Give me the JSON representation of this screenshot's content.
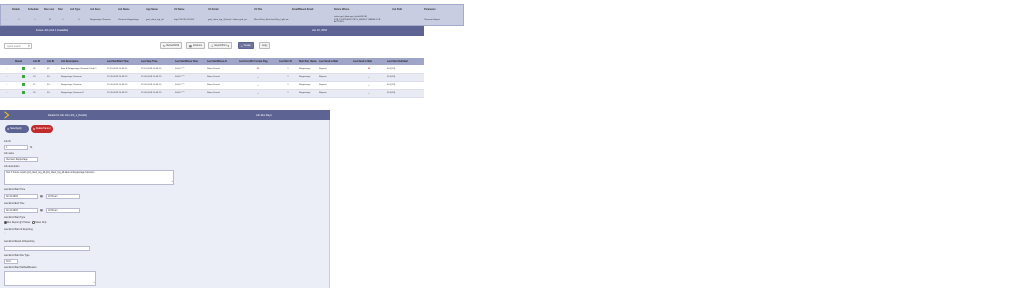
{
  "top_grid": {
    "headers": [
      "",
      "Details",
      "Schedule",
      "Run now",
      "Stat",
      "Job Type",
      "Job Desc",
      "Job Name",
      "App Name",
      "Url Name",
      "Url Email",
      "Url File",
      "Email/Based Email",
      "Notice Where",
      "Job Path",
      "Parameter"
    ],
    "row": {
      "col1": "...",
      "col2": "✓",
      "col3": "□",
      "col4": "↻",
      "col5": "✓",
      "col6": "0",
      "col7": "Reppertage Clemson",
      "col8": "Clemson Reppertage",
      "col9": "grid_client_log_all",
      "col10": "http://74.230.124.00/",
      "col11": "grid_client_log_@clemtl...lattice.grid_jor..",
      "col12": "\\Reco\\Print_Bon ftont.Rep_Lqtkr.stc",
      "col13": "",
      "col14": "select grd_fdate.grd_sfield FROM JOB_POSTERS,POSTS_RESULT PARSE JOB ACTIONS",
      "col15": "",
      "col16": "Clemson Report"
    }
  },
  "title_bar": {
    "left_text": "Future Job (Job 1 Available)",
    "right_text": "Jan 10, 2018"
  },
  "toolbar": {
    "search_placeholder": "Quick search",
    "btn_refresh": "Refresh/Poll",
    "btn_columns": "Columns",
    "btn_export": "Export/Print",
    "btn_create": "Create",
    "btn_copy": "Copy"
  },
  "job_list": {
    "headers": [
      "",
      "Result",
      "Job ID",
      "Job ID",
      "Job Description",
      "Last Run/Start Time",
      "Last Stop Time",
      "Last Start/Done Time",
      "Last Start/Done At",
      "Last Error/Type",
      "Last Error/Dir Format Flag",
      "Last Retr ID",
      "Next Run_Name",
      "Last Send to Mail",
      "Last Send to Mail",
      "Last Start-Out/Alert"
    ],
    "rows": [
      {
        "c1": "...",
        "c2": "✓",
        "c3": "28",
        "c4": "46",
        "c5": "Item E-Reppertage Clemson Draft O",
        "c6": "22-10-2018 10:09:11",
        "c7": "22-10-2018 10:09:13",
        "c8": "00:00 ****",
        "c9": "Notes Found",
        "c10": "✖",
        "c11": "1",
        "c12": "Reppertage",
        "c13": "Reports",
        "c14": "✖",
        "c15": "45.2(19)"
      },
      {
        "c1": "...",
        "c2": "✓",
        "c3": "24",
        "c4": "34",
        "c5": "Reppertage Clemson",
        "c6": "22-05-2018 10:09:13",
        "c7": "22-05-2018 10:09:13",
        "c8": "00:00 ****",
        "c9": "Notes Found",
        "c10": "✓",
        "c11": "1",
        "c12": "Reppertage",
        "c13": "Reports",
        "c14": "✓",
        "c15": "45.2(19)"
      },
      {
        "c1": "...",
        "c2": "✓",
        "c3": "22",
        "c4": "34",
        "c5": "Reppertage Clemson",
        "c6": "22-05-2018 10:09:13",
        "c7": "22-05-2018 10:09:13",
        "c8": "00:00 ****",
        "c9": "Notes Found",
        "c10": "✓",
        "c11": "1",
        "c12": "Reppertage",
        "c13": "Reports",
        "c14": "✓",
        "c15": "45.2(19)"
      },
      {
        "c1": "...",
        "c2": "✓",
        "c3": "20",
        "c4": "34",
        "c5": "Reppertage Clemson D",
        "c6": "22-05-2018 10:09:13",
        "c7": "22-05-2018 10:09:13",
        "c8": "00:00 ****",
        "c9": "Notes Found",
        "c10": "✓",
        "c11": "1",
        "c12": "Reppertage",
        "c13": "Reports",
        "c14": "✓",
        "c15": "45.2(19)"
      }
    ]
  },
  "edit_panel": {
    "header_left": "Details for Job Job (Job_1_Details)",
    "header_right": "Job Run Days",
    "save_label": "Save/Apply",
    "delete_label": "Delete/Cancel",
    "job_id_label": "Job ID",
    "job_id_value": "1",
    "job_name_label": "Job name",
    "job_name_value": "Clemson Reppertage",
    "job_desc_label": "Job description",
    "job_desc_value": "Test // Future report grid_client_log_all grid_client_log_all.tatus is Reppertage Clemson",
    "last_start_label": "Last Error/Start Time",
    "last_start_date": "02-12-2018",
    "last_start_time": "10:00 am",
    "last_end_label": "Last Error/End Time",
    "last_end_date": "02-12-2018",
    "last_end_time": "10:00 am",
    "start_type_label": "Last Error/Start Type",
    "radio_1": "Run Report @ 8 Notes",
    "radio_2": "Notes Only",
    "start_result_label": "Last Error/Start Id Reporting",
    "stop_result_label": "Last Error/Result Id Reporting",
    "status_type_label": "Last Error/Start File Type",
    "status_type_value": "Xoro",
    "notify_label": "Last Error/Start Notified/Reason"
  },
  "icons": {
    "search": "search-icon",
    "calendar": "calendar-icon",
    "logo": "chevron-logo-icon"
  },
  "colors": {
    "header_blue": "#5d6494",
    "grid_blue": "#9fa4c9",
    "panel_bg": "#eceef7",
    "delete_red": "#c22b2b",
    "check_green": "#2a9a2a"
  }
}
